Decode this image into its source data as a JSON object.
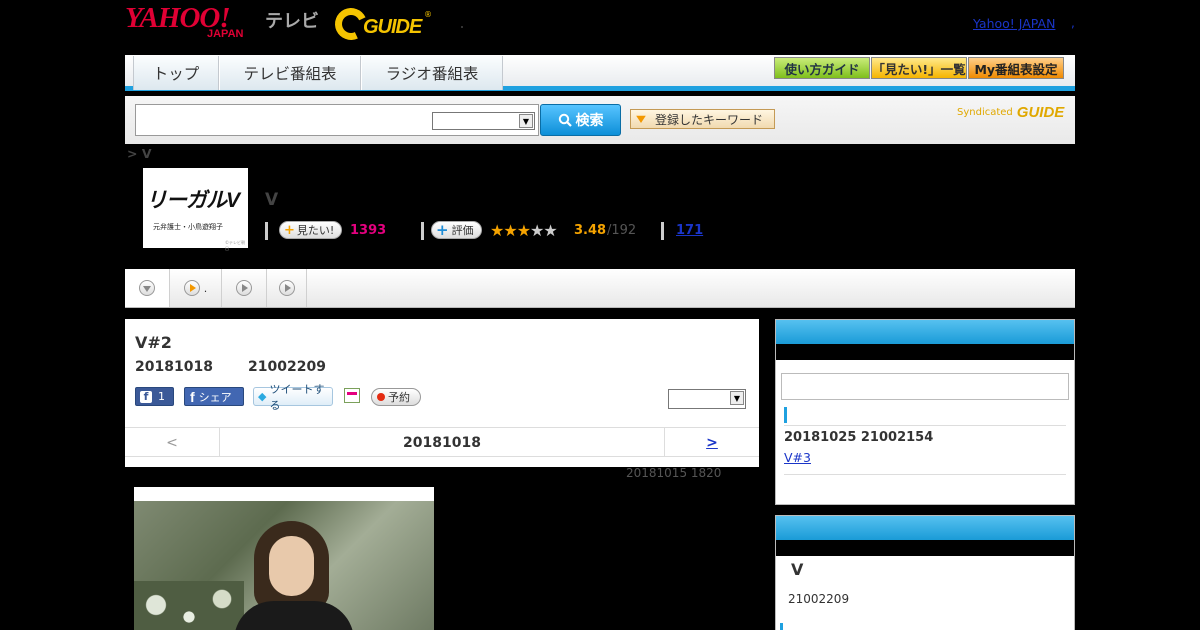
{
  "header": {
    "logo_yahoo": "YAHOO!",
    "logo_japan": "JAPAN",
    "logo_tv": "テレビ",
    "logo_gguide": "GUIDE",
    "logo_registered": "®",
    "yahoo_link": "Yahoo! JAPAN",
    "yahoo_link_suffix": ","
  },
  "nav": {
    "tabs": [
      "トップ",
      "テレビ番組表",
      "ラジオ番組表"
    ],
    "guide_button": "使い方ガイド",
    "mitai_list_button": "「見たい!」一覧",
    "my_schedule_button": "My番組表設定"
  },
  "search": {
    "input_value": "",
    "select_value": "",
    "button_label": "検索",
    "keyword_button": "登録したキーワード",
    "syndicated": "Syndicated",
    "syndicated_logo": "GUIDE"
  },
  "breadcrumb": "> V",
  "program": {
    "thumb_title": "リーガルV",
    "thumb_subtitle": "元弁護士・小鳥遊翔子",
    "thumb_copyright": "©テレビ朝日",
    "title": "V",
    "mitai_label": "見たい!",
    "mitai_count": "1393",
    "rating_label": "評価",
    "rating_stars": 3,
    "rating_score": "3.48",
    "rating_total": "/192",
    "review_count": "171"
  },
  "subtabs": [
    {
      "label": ""
    },
    {
      "label": "."
    },
    {
      "label": ""
    },
    {
      "label": ""
    }
  ],
  "episode": {
    "title": "V#2",
    "date": "20181018",
    "time": "21002209",
    "fb_like_count": "1",
    "fb_share": "シェア",
    "tweet": "ツイートする",
    "reserve": "予約",
    "select_value": "",
    "prev": "<",
    "current_date": "20181018",
    "next": ">",
    "updated": "20181015  1820"
  },
  "sidebar": {
    "next_date": "20181025  21002154",
    "next_link": "V#3  ",
    "box2_title": "V",
    "box2_time": "21002209"
  },
  "colors": {
    "accent_blue": "#1fa1e0",
    "mitai_pink": "#e4007f",
    "star_orange": "#f5a300",
    "link_blue": "#1a35c8"
  }
}
